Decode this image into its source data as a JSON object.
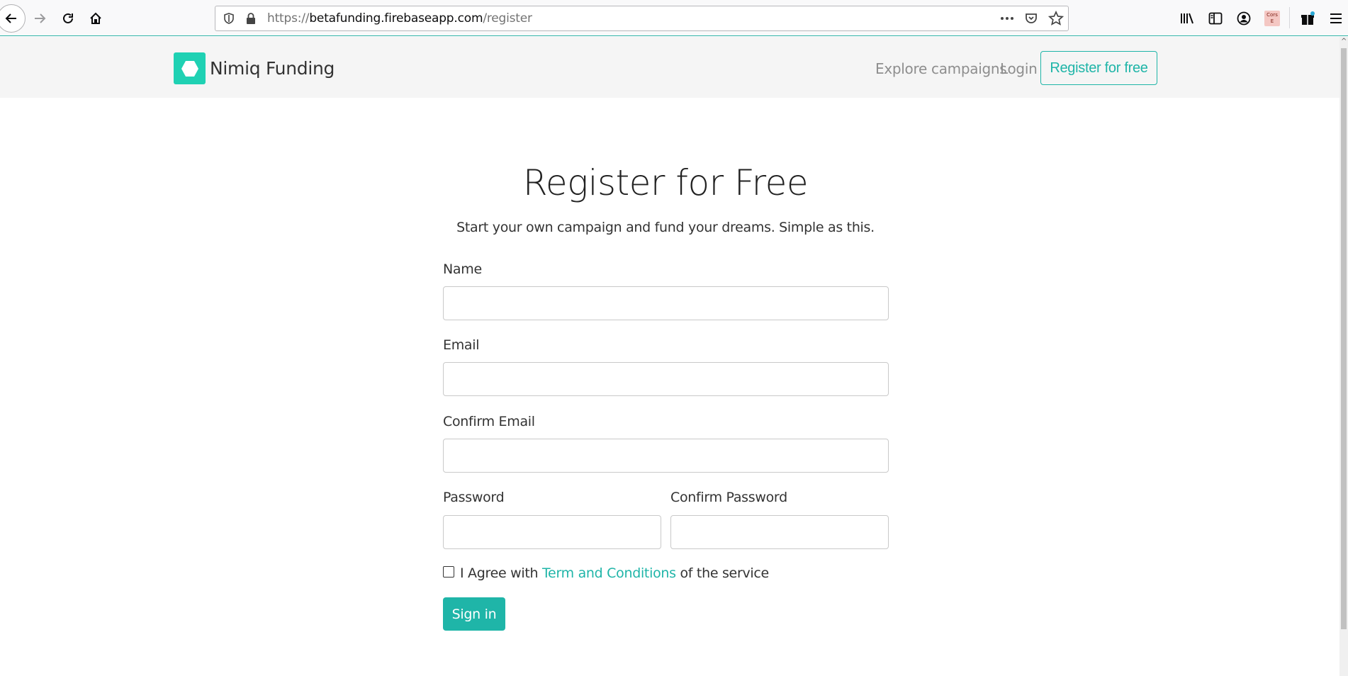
{
  "browser": {
    "url_scheme": "https://",
    "url_host": "betafunding.firebaseapp.com",
    "url_path": "/register",
    "extension_cors_label": "Cors E"
  },
  "navbar": {
    "brand_name": "Nimiq Funding",
    "links": [
      {
        "label": "Explore campaigns"
      },
      {
        "label": "Login"
      }
    ],
    "cta_label": "Register for free"
  },
  "form": {
    "title": "Register for Free",
    "subtitle": "Start your own campaign and fund your dreams. Simple as this.",
    "fields": {
      "name_label": "Name",
      "email_label": "Email",
      "confirm_email_label": "Confirm Email",
      "password_label": "Password",
      "confirm_password_label": "Confirm Password"
    },
    "agree": {
      "prefix": "I Agree with",
      "link": "Term and Conditions",
      "suffix": "of the service",
      "checked": false
    },
    "submit_label": "Sign in"
  },
  "colors": {
    "accent": "#1fb5a8",
    "logo": "#1fd1b3",
    "navbar_bg": "#f5f5f5"
  }
}
